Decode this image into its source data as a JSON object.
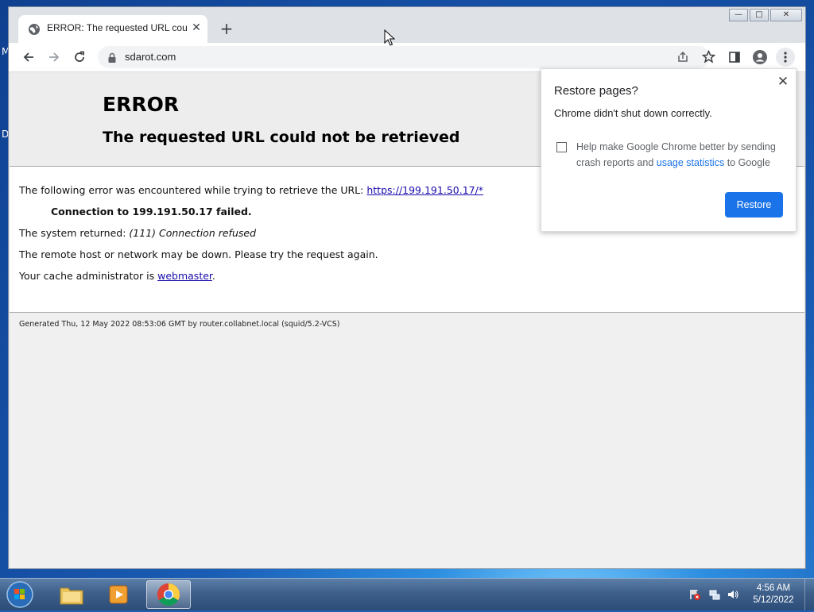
{
  "desktop": {
    "left_letters": [
      "M",
      "D"
    ]
  },
  "window_controls": {
    "minimize": "—",
    "maximize": "□",
    "close": "✕"
  },
  "tab": {
    "title": "ERROR: The requested URL could not be retrieved",
    "close": "✕"
  },
  "new_tab": "+",
  "address_bar": {
    "url": "sdarot.com"
  },
  "page": {
    "heading": "ERROR",
    "subheading": "The requested URL could not be retrieved",
    "line1_prefix": "The following error was encountered while trying to retrieve the URL: ",
    "line1_link": "https://199.191.50.17/*",
    "connection_failed": "Connection to 199.191.50.17 failed.",
    "system_returned_label": "The system returned: ",
    "system_returned_value": "(111) Connection refused",
    "remote_host": "The remote host or network may be down. Please try the request again.",
    "cache_admin_prefix": "Your cache administrator is ",
    "cache_admin_link": "webmaster",
    "cache_admin_suffix": ".",
    "footer": "Generated Thu, 12 May 2022 08:53:06 GMT by router.collabnet.local (squid/5.2-VCS)"
  },
  "restore_popup": {
    "title": "Restore pages?",
    "message": "Chrome didn't shut down correctly.",
    "help_text_1": "Help make Google Chrome better by sending crash reports and ",
    "help_link": "usage statistics",
    "help_text_2": " to Google",
    "restore_button": "Restore",
    "checkbox_checked": false
  },
  "taskbar": {
    "clock_time": "4:56 AM",
    "clock_date": "5/12/2022"
  },
  "colors": {
    "accent": "#1a73e8",
    "link": "#1a0dab"
  }
}
